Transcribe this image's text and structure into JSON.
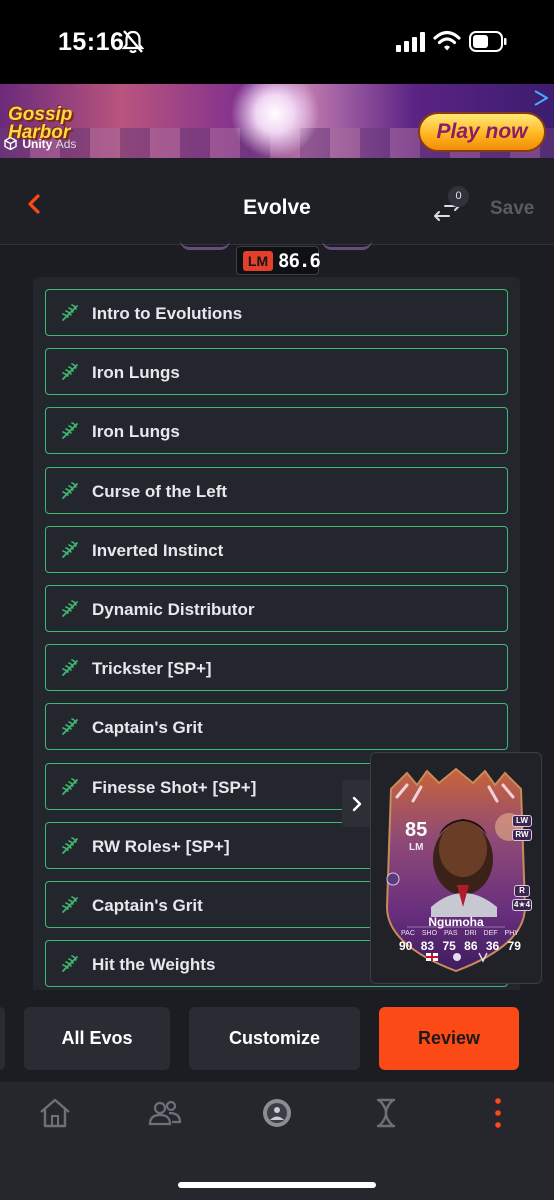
{
  "status_bar": {
    "time": "15:16",
    "icons": [
      "bell-off-icon",
      "signal-icon",
      "wifi-icon",
      "battery-icon"
    ]
  },
  "ad": {
    "logo_text": "Gossip Harbor",
    "network_brand": "Unity",
    "network_suffix": "Ads",
    "cta_label": "Play now"
  },
  "header": {
    "title": "Evolve",
    "back_icon": "chevron-left-icon",
    "swap_icon": "swap-arrows-icon",
    "swap_count": "0",
    "save_label": "Save",
    "accent_color": "#fc4a16"
  },
  "rating": {
    "position": "LM",
    "value": "86.6"
  },
  "evolutions": [
    {
      "label": "Intro to Evolutions"
    },
    {
      "label": "Iron Lungs"
    },
    {
      "label": "Iron Lungs"
    },
    {
      "label": "Curse of the Left"
    },
    {
      "label": "Inverted Instinct"
    },
    {
      "label": "Dynamic Distributor"
    },
    {
      "label": "Trickster [SP+]"
    },
    {
      "label": "Captain's Grit"
    },
    {
      "label": "Finesse Shot+ [SP+]"
    },
    {
      "label": "RW Roles+ [SP+]"
    },
    {
      "label": "Captain's Grit"
    },
    {
      "label": "Hit the Weights"
    }
  ],
  "evolution_border_color": "#3fb872",
  "player_card": {
    "rating": "85",
    "position": "LM",
    "alt_positions": [
      "LW",
      "RW"
    ],
    "weak_foot": "R",
    "skills": "4★4",
    "name": "Ngumoha",
    "stat_labels": [
      "PAC",
      "SHO",
      "PAS",
      "DRI",
      "DEF",
      "PHY"
    ],
    "stat_values": [
      "90",
      "83",
      "75",
      "86",
      "36",
      "79"
    ]
  },
  "actions": {
    "all_evos": "All Evos",
    "customize": "Customize",
    "review": "Review"
  },
  "bottom_nav": {
    "items": [
      "home-icon",
      "squad-icon",
      "club-badge-icon",
      "evolutions-dna-icon",
      "more-menu-icon"
    ],
    "active_color": "#fc4a16"
  }
}
